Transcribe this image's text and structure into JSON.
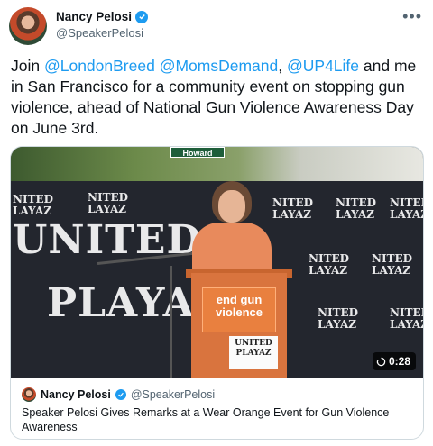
{
  "author": {
    "display_name": "Nancy Pelosi",
    "handle": "@SpeakerPelosi",
    "verified": true
  },
  "more_icon": "more-horizontal-icon",
  "tweet": {
    "parts": [
      {
        "text": "Join ",
        "mention": false
      },
      {
        "text": "@LondonBreed",
        "mention": true
      },
      {
        "text": " ",
        "mention": false
      },
      {
        "text": "@MomsDemand",
        "mention": true
      },
      {
        "text": ", ",
        "mention": false
      },
      {
        "text": "@UP4Life",
        "mention": true
      },
      {
        "text": " and me in San Francisco for a community event on stopping gun violence, ahead of National Gun Violence Awareness Day on June 3rd.",
        "mention": false
      }
    ]
  },
  "media": {
    "street_sign": "Howard",
    "backdrop_small_top": "NITED",
    "backdrop_small_bottom": "LAYAZ",
    "backdrop_big_1": "UNITED",
    "backdrop_big_2": "PLAYAZ",
    "podium_sign_line1": "end gun",
    "podium_sign_line2": "violence",
    "podium_logo_line1": "UNITED",
    "podium_logo_line2": "PLAYAZ",
    "duration": "0:28",
    "duration_icon": "replay-icon"
  },
  "quoted": {
    "display_name": "Nancy Pelosi",
    "handle": "@SpeakerPelosi",
    "verified": true,
    "text": "Speaker Pelosi Gives Remarks at a Wear Orange Event for Gun Violence Awareness"
  },
  "colors": {
    "link": "#1d9bf0",
    "muted": "#536471",
    "text": "#0f1419",
    "border": "#cfd9de"
  }
}
